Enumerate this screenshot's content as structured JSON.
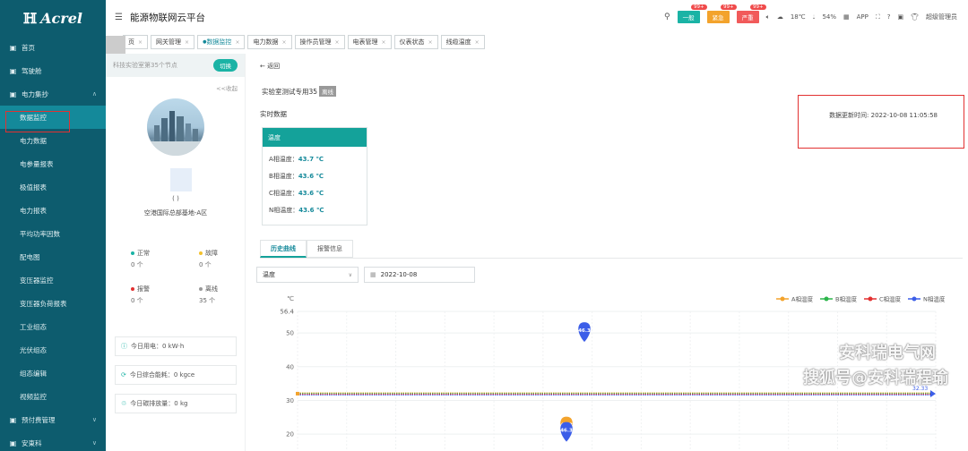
{
  "app": {
    "logo": "Acrel",
    "title": "能源物联网云平台"
  },
  "header": {
    "badges": [
      {
        "label": "一般",
        "count": "99+",
        "color": "#1ab3a5"
      },
      {
        "label": "紧急",
        "count": "99+",
        "color": "#f3a32c"
      },
      {
        "label": "严重",
        "count": "99+",
        "color": "#f15a5a"
      }
    ],
    "temperature": "18℃",
    "humidity": "54%",
    "app_label": "APP",
    "user": "超级管理员"
  },
  "sidebar": {
    "items": [
      {
        "label": "首页",
        "icon": "home-icon"
      },
      {
        "label": "驾驶舱",
        "icon": "cockpit-icon"
      },
      {
        "label": "电力集抄",
        "icon": "power-icon",
        "expanded": true
      },
      {
        "label": "数据监控",
        "active": true
      },
      {
        "label": "电力数据"
      },
      {
        "label": "电参量报表"
      },
      {
        "label": "极值报表"
      },
      {
        "label": "电力报表"
      },
      {
        "label": "平均功率因数"
      },
      {
        "label": "配电图"
      },
      {
        "label": "变压器监控"
      },
      {
        "label": "变压器负荷报表"
      },
      {
        "label": "工业组态"
      },
      {
        "label": "光伏组态"
      },
      {
        "label": "组态编辑"
      },
      {
        "label": "视频监控"
      },
      {
        "label": "预付费管理",
        "icon": "prepay-icon"
      },
      {
        "label": "安東科",
        "icon": "misc-icon"
      }
    ]
  },
  "tabs": [
    {
      "label": "页"
    },
    {
      "label": "网关管理"
    },
    {
      "label": "数据监控",
      "active": true
    },
    {
      "label": "电力数据"
    },
    {
      "label": "操作员管理"
    },
    {
      "label": "电表管理"
    },
    {
      "label": "仪表状态"
    },
    {
      "label": "线缆温度"
    }
  ],
  "left_panel": {
    "site_hint": "科技实验室第35个节点",
    "switch_label": "切换",
    "collapse_label": "<<收起",
    "paren": "( )",
    "station_name": "空港国际总部基地-A区",
    "stats": [
      {
        "label": "正常",
        "value": "0 个",
        "color": "#1ab3a5"
      },
      {
        "label": "故障",
        "value": "0 个",
        "color": "#f3c12c"
      },
      {
        "label": "报警",
        "value": "0 个",
        "color": "#e23131"
      },
      {
        "label": "离线",
        "value": "35 个",
        "color": "#999999"
      }
    ],
    "energy": [
      {
        "label": "今日用电：0 kW·h"
      },
      {
        "label": "今日综合能耗：0 kgce"
      },
      {
        "label": "今日碳排放量：0 kg"
      }
    ]
  },
  "main": {
    "back_label": "返回",
    "device_name": "实验室测试专用35",
    "offline_tag": "离线",
    "realtime_label": "实时数据",
    "update_time": "数据更新时间: 2022-10-08 11:05:58",
    "temp_card": {
      "header": "温度",
      "rows": [
        {
          "label": "A相温度：",
          "value": "43.7 ℃"
        },
        {
          "label": "B相温度：",
          "value": "43.6 ℃"
        },
        {
          "label": "C相温度：",
          "value": "43.6 ℃"
        },
        {
          "label": "N相温度：",
          "value": "43.6 ℃"
        }
      ]
    },
    "subtabs": [
      {
        "label": "历史曲线",
        "active": true
      },
      {
        "label": "报警信息"
      }
    ],
    "select_value": "温度",
    "date_value": "2022-10-08"
  },
  "chart_data": {
    "type": "line",
    "ylabel": "℃",
    "ylim": [
      15,
      56.4
    ],
    "yticks": [
      "56.4",
      "50",
      "40",
      "30",
      "20"
    ],
    "series": [
      {
        "name": "A相温度",
        "color": "#f3a32c"
      },
      {
        "name": "B相温度",
        "color": "#2cb54a"
      },
      {
        "name": "C相温度",
        "color": "#e23131"
      },
      {
        "name": "N相温度",
        "color": "#3c5ee8"
      }
    ],
    "baseline_value": 32,
    "max_marker": {
      "value": 50,
      "label": "46.3"
    },
    "min_marker": {
      "value": 22,
      "label": "46.3"
    },
    "end_label": "32.33"
  },
  "watermark": {
    "line1": "安科瑞电气网",
    "line2": "搜狐号@安科瑞程瑜"
  }
}
